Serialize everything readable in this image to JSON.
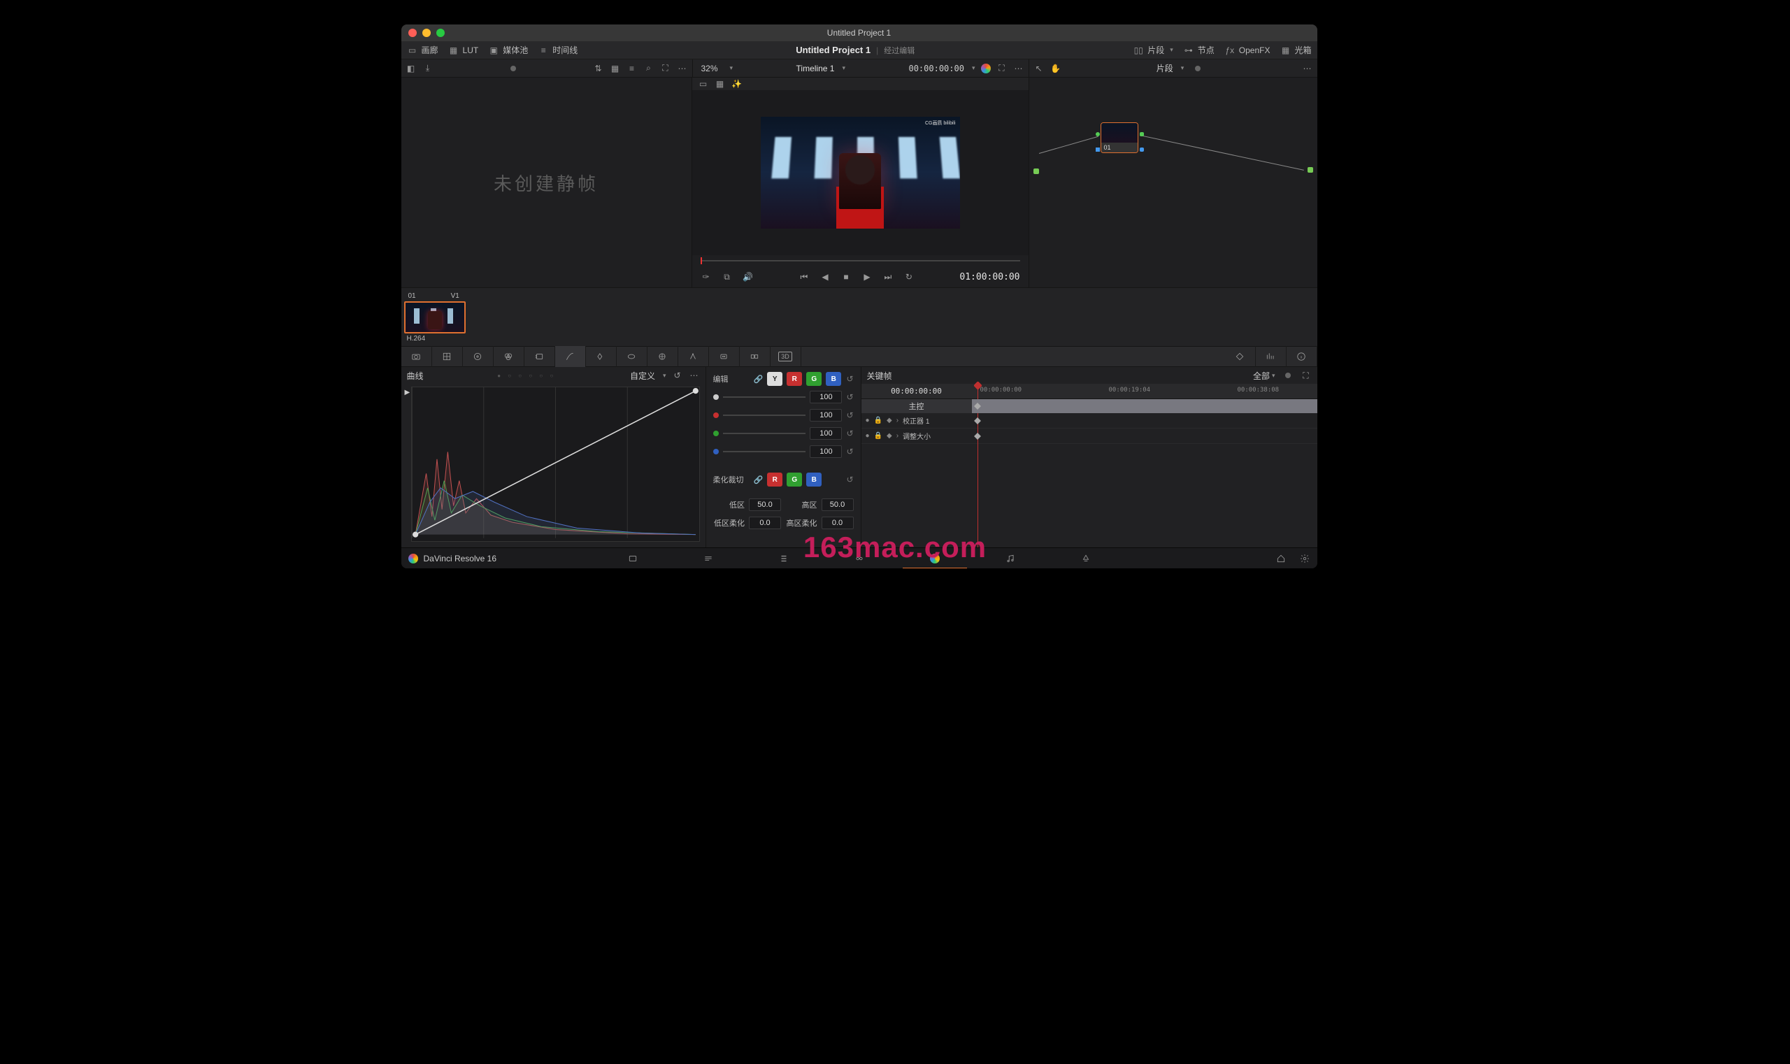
{
  "window": {
    "title": "Untitled Project 1"
  },
  "topbar": {
    "gallery": "画廊",
    "lut": "LUT",
    "mediapool": "媒体池",
    "timeline": "时间线",
    "project": "Untitled Project 1",
    "edited": "经过编辑",
    "clips": "片段",
    "nodes": "节点",
    "openfx": "OpenFX",
    "lightbox": "光箱"
  },
  "subbar": {
    "zoom": "32%",
    "timeline_name": "Timeline 1",
    "timecode": "00:00:00:00",
    "right_label": "片段"
  },
  "gallery": {
    "placeholder": "未创建静帧"
  },
  "viewer": {
    "timecode": "01:00:00:00",
    "watermark": "CG画质  bilibili"
  },
  "nodegraph": {
    "node_label": "01"
  },
  "clips": {
    "num": "01",
    "track": "V1",
    "codec": "H.264"
  },
  "curves": {
    "title": "曲线",
    "mode": "自定义",
    "edit_label": "编辑",
    "soft_label": "柔化裁切",
    "channels": {
      "y": "Y",
      "r": "R",
      "g": "G",
      "b": "B"
    },
    "values": {
      "w": "100",
      "r": "100",
      "g": "100",
      "b": "100"
    },
    "low": "低区",
    "high": "高区",
    "low_soft": "低区柔化",
    "high_soft": "高区柔化",
    "low_val": "50.0",
    "high_val": "50.0",
    "low_soft_val": "0.0",
    "high_soft_val": "0.0"
  },
  "keyframes": {
    "title": "关键帧",
    "all": "全部",
    "center_tc": "00:00:00:00",
    "ticks": [
      "00:00:00:00",
      "00:00:19:04",
      "00:00:38:08"
    ],
    "master": "主控",
    "tracks": [
      "校正器 1",
      "调整大小"
    ]
  },
  "bottombar": {
    "app": "DaVinci Resolve 16"
  },
  "watermark": "163mac.com"
}
